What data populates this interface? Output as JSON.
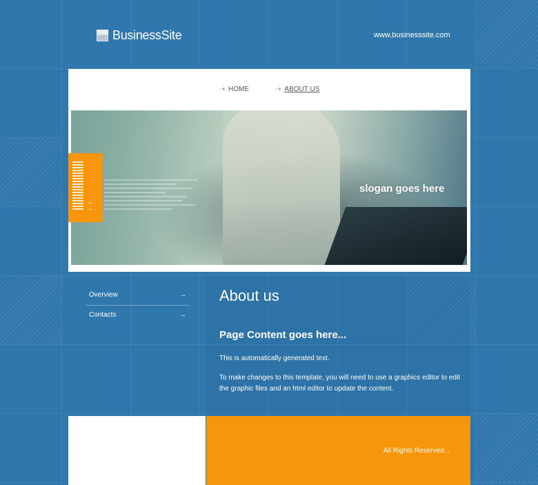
{
  "header": {
    "logo_text": "BusinessSite",
    "site_url": "www.businesssite.com"
  },
  "nav": {
    "items": [
      {
        "label": "HOME",
        "active": false
      },
      {
        "label": "ABOUT US",
        "active": true
      }
    ]
  },
  "hero": {
    "slogan": "slogan goes here"
  },
  "sidebar": {
    "items": [
      {
        "label": "Overview"
      },
      {
        "label": "Contacts"
      }
    ]
  },
  "main": {
    "page_title": "About us",
    "heading": "Page Content goes here...",
    "paragraph_1": "This is automatically generated text.",
    "paragraph_2": "To make changes to this template, you will need to use a graphics editor to edit the graphic files and an html editor to update the content."
  },
  "footer": {
    "copyright": "All Rights Reserved..."
  },
  "colors": {
    "background": "#2f77ad",
    "accent": "#f7960a",
    "panel": "#ffffff"
  }
}
